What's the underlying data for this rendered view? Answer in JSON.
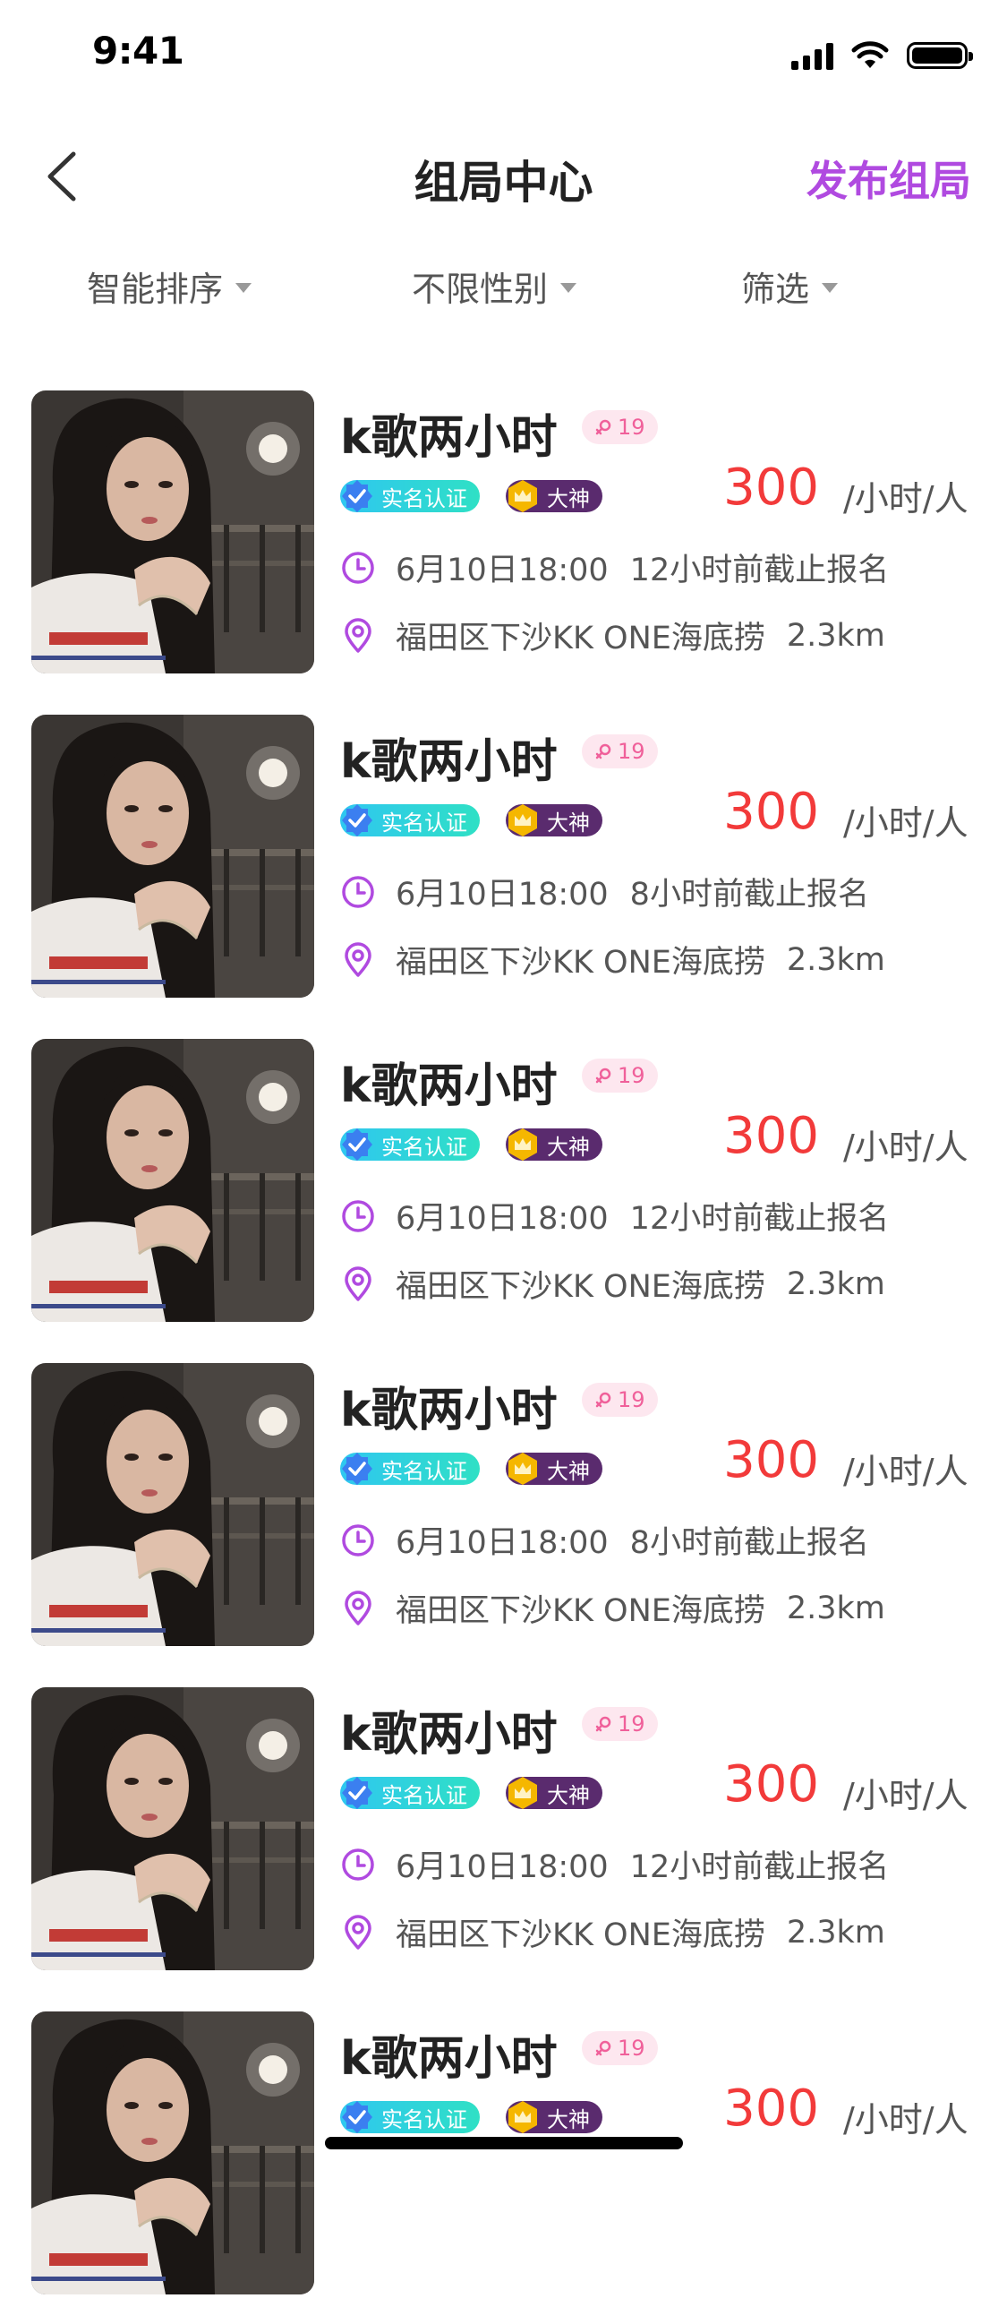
{
  "status_bar": {
    "time": "9:41"
  },
  "nav": {
    "title": "组局中心",
    "action": "发布组局"
  },
  "filters": [
    {
      "label": "智能排序"
    },
    {
      "label": "不限性别"
    },
    {
      "label": "筛选"
    }
  ],
  "icons": {
    "back": "chevron-left-icon",
    "caret": "caret-down-icon",
    "clock": "clock-icon",
    "location": "location-pin-icon",
    "female": "female-icon",
    "verify": "verified-badge-icon",
    "crown": "crown-badge-icon"
  },
  "colors": {
    "accent": "#b04ae0",
    "price": "#f23a3a",
    "gender_badge_bg": "#fde7ef",
    "gender_badge_text": "#f0609a",
    "verify_tag": "#2fd6d8",
    "god_tag": "#5a2b6e"
  },
  "items": [
    {
      "title": "k歌两小时",
      "age": "19",
      "verify_tag": "实名认证",
      "level_tag": "大神",
      "price": "300",
      "unit": "/小时/人",
      "datetime": "6月10日18:00",
      "deadline": "12小时前截止报名",
      "location": "福田区下沙KK ONE海底捞",
      "distance": "2.3km"
    },
    {
      "title": "k歌两小时",
      "age": "19",
      "verify_tag": "实名认证",
      "level_tag": "大神",
      "price": "300",
      "unit": "/小时/人",
      "datetime": "6月10日18:00",
      "deadline": "8小时前截止报名",
      "location": "福田区下沙KK ONE海底捞",
      "distance": "2.3km"
    },
    {
      "title": "k歌两小时",
      "age": "19",
      "verify_tag": "实名认证",
      "level_tag": "大神",
      "price": "300",
      "unit": "/小时/人",
      "datetime": "6月10日18:00",
      "deadline": "12小时前截止报名",
      "location": "福田区下沙KK ONE海底捞",
      "distance": "2.3km"
    },
    {
      "title": "k歌两小时",
      "age": "19",
      "verify_tag": "实名认证",
      "level_tag": "大神",
      "price": "300",
      "unit": "/小时/人",
      "datetime": "6月10日18:00",
      "deadline": "8小时前截止报名",
      "location": "福田区下沙KK ONE海底捞",
      "distance": "2.3km"
    },
    {
      "title": "k歌两小时",
      "age": "19",
      "verify_tag": "实名认证",
      "level_tag": "大神",
      "price": "300",
      "unit": "/小时/人",
      "datetime": "6月10日18:00",
      "deadline": "12小时前截止报名",
      "location": "福田区下沙KK ONE海底捞",
      "distance": "2.3km"
    },
    {
      "title": "k歌两小时",
      "age": "19",
      "verify_tag": "实名认证",
      "level_tag": "大神",
      "price": "300",
      "unit": "/小时/人"
    }
  ]
}
